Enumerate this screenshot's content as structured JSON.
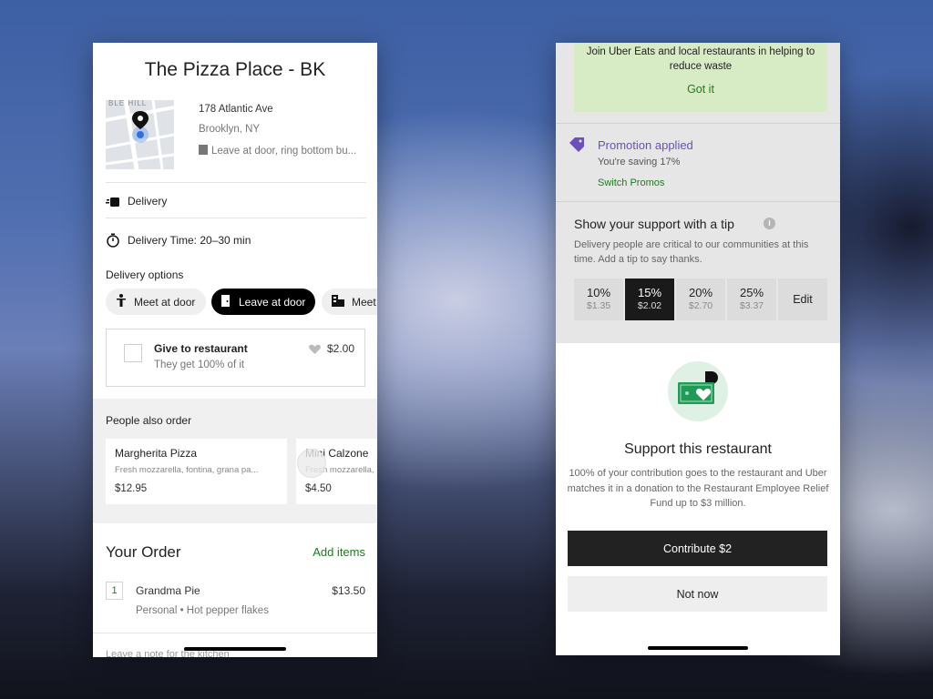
{
  "left": {
    "store_title": "The Pizza Place - BK",
    "map_text": "BLE HILL",
    "address_line1": "178 Atlantic Ave",
    "address_line2": "Brooklyn, NY",
    "address_note": "Leave at door, ring bottom bu...",
    "delivery_label": "Delivery",
    "delivery_time": "Delivery Time: 20–30 min",
    "delivery_options_label": "Delivery options",
    "options": [
      "Meet at door",
      "Leave at door",
      "Meet"
    ],
    "selected_option": "Leave at door",
    "give": {
      "title": "Give to restaurant",
      "subtitle": "They get 100% of it",
      "price": "$2.00",
      "checked": false
    },
    "people_also_order_label": "People also order",
    "items": [
      {
        "name": "Margherita Pizza",
        "desc": "Fresh mozzarella, fontina, grana pa...",
        "price": "$12.95"
      },
      {
        "name": "Mini Calzone",
        "desc": "Fresh mozzarella,",
        "price": "$4.50"
      }
    ],
    "your_order_title": "Your Order",
    "add_items_label": "Add items",
    "order_item": {
      "qty": "1",
      "name": "Grandma Pie",
      "price": "$13.50",
      "options": "Personal • Hot pepper flakes"
    },
    "note_placeholder": "Leave a note for the kitchen"
  },
  "right": {
    "banner_text": "Join Uber Eats and local restaurants in helping to reduce waste",
    "banner_action": "Got it",
    "promo_title": "Promotion applied",
    "promo_sub": "You're saving 17%",
    "promo_action": "Switch Promos",
    "tip_title": "Show your support with a tip",
    "tip_desc": "Delivery people are critical to our communities at this time. Add a tip to say thanks.",
    "tips": [
      {
        "pct": "10%",
        "amt": "$1.35"
      },
      {
        "pct": "15%",
        "amt": "$2.02"
      },
      {
        "pct": "20%",
        "amt": "$2.70"
      },
      {
        "pct": "25%",
        "amt": "$3.37"
      }
    ],
    "selected_tip": "15%",
    "tip_edit": "Edit",
    "sheet_title": "Support this restaurant",
    "sheet_desc": "100% of your contribution goes to the restaurant and Uber matches it in a donation to the Restaurant Employee Relief Fund up to $3 million.",
    "contribute_label": "Contribute $2",
    "not_now_label": "Not now"
  },
  "colors": {
    "accent_green": "#1f7a1f",
    "promo_purple": "#6b4fbb",
    "banner_green": "#d7ecc5",
    "dark": "#1a1a1a"
  }
}
